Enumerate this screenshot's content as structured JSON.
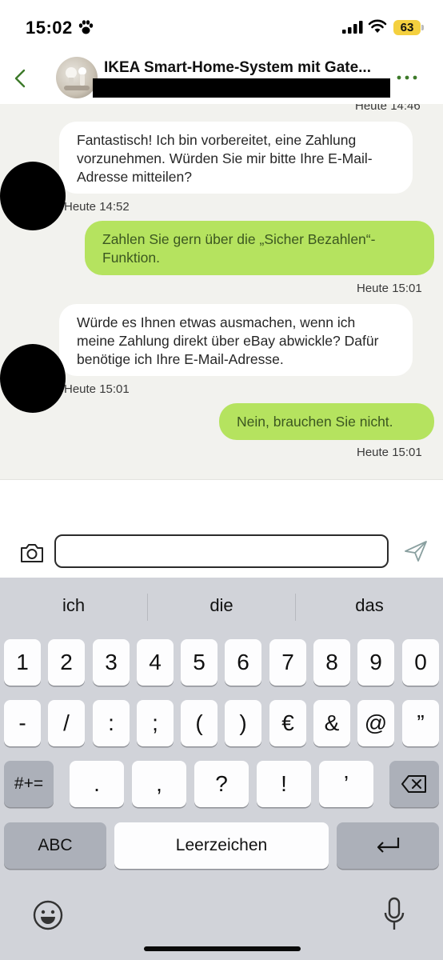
{
  "status_bar": {
    "time": "15:02",
    "battery": "63"
  },
  "header": {
    "title": "IKEA Smart-Home-System mit Gate..."
  },
  "chat": {
    "top_timestamp": "Heute 14:46",
    "messages": [
      {
        "dir": "in",
        "text": "Fantastisch! Ich bin vorbereitet, eine Zahlung vorzunehmen. Würden Sie mir bitte Ihre E-Mail-Adresse mitteilen?",
        "time": "Heute 14:52"
      },
      {
        "dir": "out",
        "text": "Zahlen Sie gern über die „Sicher Bezahlen“-Funktion.",
        "time": "Heute 15:01"
      },
      {
        "dir": "in",
        "text": "Würde es Ihnen etwas ausmachen, wenn ich meine Zahlung direkt über eBay abwickle? Dafür benötige ich Ihre E-Mail-Adresse.",
        "time": "Heute 15:01"
      },
      {
        "dir": "out",
        "text": "Nein, brauchen Sie nicht.",
        "time": "Heute 15:01"
      }
    ]
  },
  "composer": {
    "value": ""
  },
  "keyboard": {
    "suggestions": [
      "ich",
      "die",
      "das"
    ],
    "row1": [
      "1",
      "2",
      "3",
      "4",
      "5",
      "6",
      "7",
      "8",
      "9",
      "0"
    ],
    "row2": [
      "-",
      "/",
      ":",
      ";",
      "(",
      ")",
      "€",
      "&",
      "@",
      "”"
    ],
    "row3": [
      ".",
      ",",
      "?",
      "!",
      "’"
    ],
    "mode_key": "#+=",
    "abc_key": "ABC",
    "space_key": "Leerzeichen"
  }
}
